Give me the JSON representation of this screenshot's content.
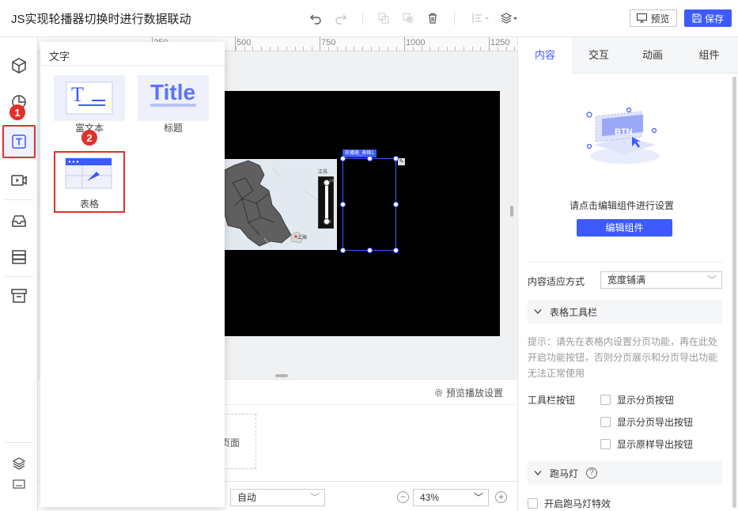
{
  "app": {
    "title": "JS实现轮播器切换时进行数据联动"
  },
  "toolbar": {
    "preview_label": "预览",
    "save_label": "保存"
  },
  "rail": {
    "step_badges": [
      "1",
      "2"
    ]
  },
  "ruler": {
    "labels": [
      "250",
      "500",
      "750",
      "1000",
      "1250"
    ]
  },
  "popup": {
    "title": "文字",
    "items": [
      {
        "label": "富文本",
        "thumb_text": "T"
      },
      {
        "label": "标题",
        "thumb_text": "Title"
      },
      {
        "label": "表格"
      }
    ]
  },
  "canvas": {
    "selected_tag": "轮播器_表格1",
    "slider_top": "100",
    "slider_bottom": "0",
    "map_labels": [
      "上海",
      "江苏"
    ]
  },
  "bottom": {
    "preview_settings": "预览播放设置",
    "page_card_text": "页面",
    "layout_select": "自动",
    "zoom_value": "43%",
    "zoom_minus": "−",
    "zoom_plus": "+"
  },
  "right_panel": {
    "tabs": [
      "内容",
      "交互",
      "动画",
      "组件"
    ],
    "active_tab": "内容",
    "illustration_text": "BTN",
    "hint": "请点击编辑组件进行设置",
    "edit_button": "编辑组件",
    "fit_label": "内容适应方式",
    "fit_value": "宽度铺满",
    "toolbar_section": "表格工具栏",
    "tip": "提示：请先在表格内设置分页功能，再在此处开启功能按钮，否则分页展示和分页导出功能无法正常使用",
    "toolbar_buttons_label": "工具栏按钮",
    "checkboxes": [
      "显示分页按钮",
      "显示分页导出按钮",
      "显示原样导出按钮"
    ],
    "marquee_section": "跑马灯",
    "marquee_help": "?",
    "marquee_checkbox": "开启跑马灯特效"
  },
  "colors": {
    "accent": "#3d5afe",
    "highlight_red": "#e0302b",
    "canvas_bg": "#000000"
  }
}
